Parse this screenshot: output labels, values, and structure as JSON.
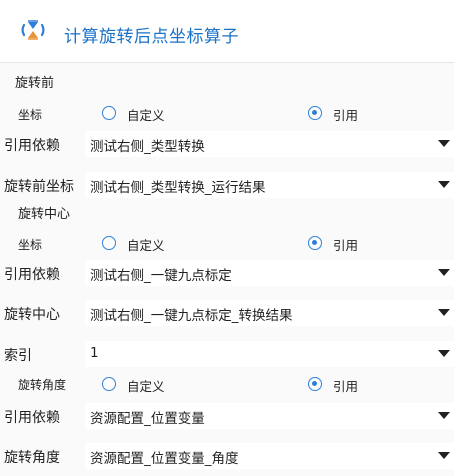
{
  "header": {
    "title": "计算旋转后点坐标算子",
    "logo_icon": "operator-logo-icon"
  },
  "sections": {
    "before_rotation": "旋转前",
    "rotation_center": "旋转中心"
  },
  "point_before": {
    "coord_label": "坐标",
    "option_custom": "自定义",
    "option_ref": "引用",
    "selected": "引用",
    "dependency_label": "引用依赖",
    "dependency_value": "测试右侧_类型转换",
    "field_label": "旋转前坐标",
    "field_value": "测试右侧_类型转换_运行结果"
  },
  "center": {
    "coord_label": "坐标",
    "option_custom": "自定义",
    "option_ref": "引用",
    "selected": "引用",
    "dependency_label": "引用依赖",
    "dependency_value": "测试右侧_一键九点标定",
    "field_label": "旋转中心",
    "field_value": "测试右侧_一键九点标定_转换结果"
  },
  "index": {
    "label": "索引",
    "value": "1"
  },
  "angle": {
    "label": "旋转角度",
    "option_custom": "自定义",
    "option_ref": "引用",
    "selected": "引用",
    "dependency_label": "引用依赖",
    "dependency_value": "资源配置_位置变量",
    "field_label": "旋转角度",
    "field_value": "资源配置_位置变量_角度"
  },
  "colors": {
    "accent": "#2f7fd8",
    "title": "#1a73c8"
  }
}
